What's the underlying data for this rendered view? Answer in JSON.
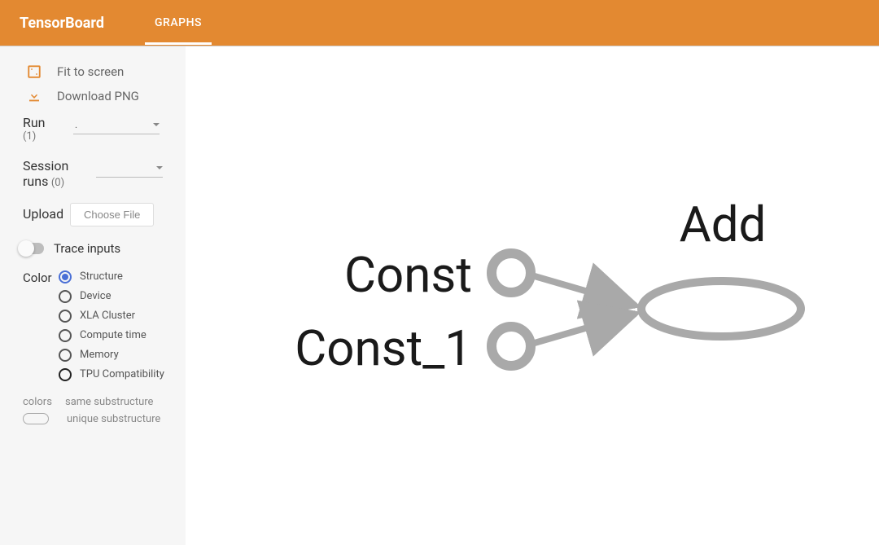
{
  "header": {
    "logo": "TensorBoard",
    "tab": "GRAPHS"
  },
  "sidebar": {
    "fit_label": "Fit to screen",
    "download_label": "Download PNG",
    "run_label": "Run",
    "run_count": "(1)",
    "run_value": ".",
    "session_label": "Session runs",
    "session_count": "(0)",
    "upload_label": "Upload",
    "choose_file_label": "Choose File",
    "trace_label": "Trace inputs",
    "color_label": "Color",
    "color_options": [
      "Structure",
      "Device",
      "XLA Cluster",
      "Compute time",
      "Memory",
      "TPU Compatibility"
    ],
    "legend_header": "colors",
    "legend_same": "same substructure",
    "legend_unique": "unique substructure"
  },
  "graph": {
    "nodes": [
      {
        "id": "Const",
        "label": "Const"
      },
      {
        "id": "Const_1",
        "label": "Const_1"
      },
      {
        "id": "Add",
        "label": "Add"
      }
    ],
    "edges": [
      {
        "from": "Const",
        "to": "Add"
      },
      {
        "from": "Const_1",
        "to": "Add"
      }
    ]
  }
}
